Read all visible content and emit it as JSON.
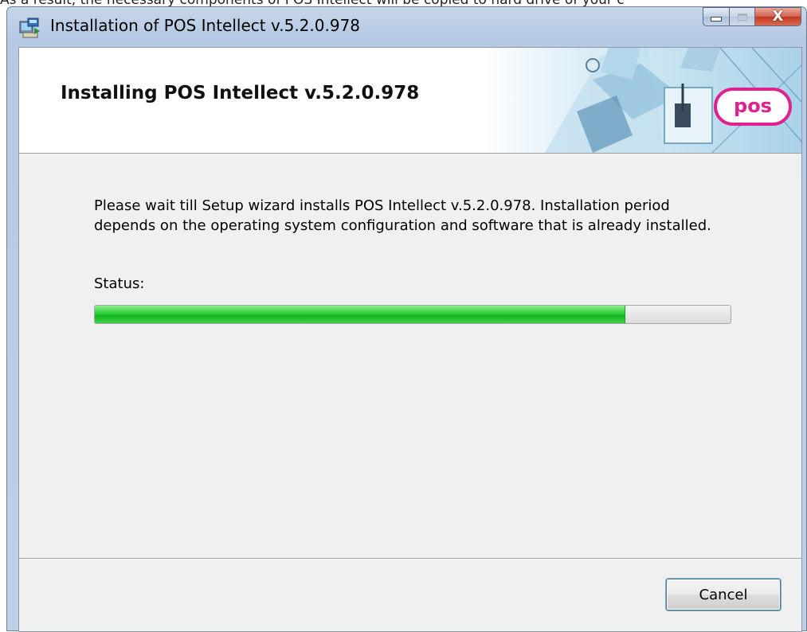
{
  "document": {
    "caption_text": "As a result, the necessary components of POS Intellect will be copied to hard drive of your c"
  },
  "window": {
    "title": "Installation of POS Intellect v.5.2.0.978",
    "close_glyph": "X",
    "app_icon": "installer-icon"
  },
  "banner": {
    "title": "Installing POS Intellect v.5.2.0.978",
    "logo_text": "pos",
    "logo_color": "#e0228e"
  },
  "main": {
    "description": "Please wait till Setup wizard installs POS Intellect v.5.2.0.978. Installation period depends on the operating system configuration and software that is already installed.",
    "status_label": "Status:",
    "progress_fraction": 0.835,
    "progress_color": "#1fc22a"
  },
  "footer": {
    "cancel_label": "Cancel"
  }
}
